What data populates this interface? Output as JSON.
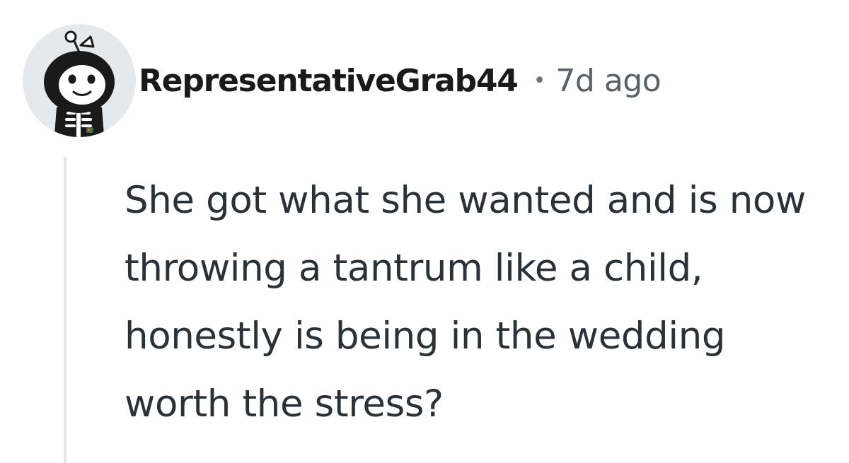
{
  "comment": {
    "username": "RepresentativeGrab44",
    "separator": "•",
    "timestamp": "7d ago",
    "body": "She got what she wanted and is now throwing a tantrum like a child, honestly is being in the wedding worth the stress?"
  },
  "icons": {
    "avatar": "reddit-snoo-skeleton-avatar-icon"
  },
  "colors": {
    "avatar_background": "#e6e9ec",
    "thread_line": "#e3e5e8",
    "timestamp": "#586068"
  }
}
